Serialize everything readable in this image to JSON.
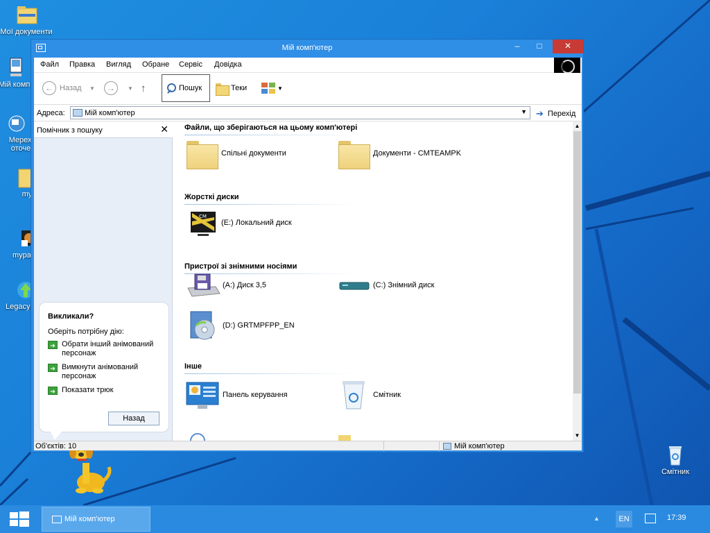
{
  "desktop": {
    "icons": [
      {
        "label": "Мої документи"
      },
      {
        "label": "Мій комп"
      },
      {
        "label": "Мереж",
        "label2": "оточе"
      },
      {
        "label": "myp"
      },
      {
        "label": "mypal"
      },
      {
        "label": "LegacyU"
      },
      {
        "label": "Смітник"
      }
    ]
  },
  "window": {
    "title": "Мій комп'ютер",
    "min_label": "–",
    "max_label": "□",
    "close_label": "✕"
  },
  "menubar": {
    "items": [
      "Файл",
      "Правка",
      "Вигляд",
      "Обране",
      "Сервіс",
      "Довідка"
    ]
  },
  "toolbar": {
    "back_label": "Назад",
    "back_icon": "←",
    "forward_icon": "→",
    "up_icon": "↑",
    "dropdown_icon": "▼",
    "search_label": "Пошук",
    "folders_label": "Теки"
  },
  "address": {
    "label": "Адреса:",
    "value": "Мій комп'ютер",
    "go_label": "Перехід",
    "go_icon": "➔"
  },
  "assistant": {
    "title": "Помічник з пошуку",
    "close_icon": "✕",
    "balloon_title": "Викликали?",
    "balloon_subtitle": "Оберіть потрібну дію:",
    "options": [
      "Обрати інший анімований персонаж",
      "Вимкнути анімований персонаж",
      "Показати трюк"
    ],
    "back_button": "Назад"
  },
  "groups": [
    {
      "title": "Файли, що зберігаються на цьому комп'ютері"
    },
    {
      "title": "Жорсткі диски"
    },
    {
      "title": "Пристрої зі знімними носіями"
    },
    {
      "title": "Інше"
    }
  ],
  "items": {
    "shared_docs": "Спільні документи",
    "user_docs": "Документи - CMTEAMPK",
    "disk_e": "(E:) Локальний диск",
    "disk_a": "(A:) Диск 3,5",
    "disk_c": "(C:) Знімний диск",
    "disk_d": "(D:) GRTMPFPP_EN",
    "control_panel": "Панель керування",
    "recycle_bin": "Смітник"
  },
  "statusbar": {
    "objects": "Об'єктів: 10",
    "location": "Мій комп'ютер"
  },
  "taskbar": {
    "task_label": "Мій комп'ютер",
    "lang": "EN",
    "clock": "17:39",
    "tray_arrow": "▲"
  },
  "colors": {
    "accent": "#2f8ee6",
    "close_red": "#c73b37",
    "taskbar": "#2a8ae0"
  }
}
